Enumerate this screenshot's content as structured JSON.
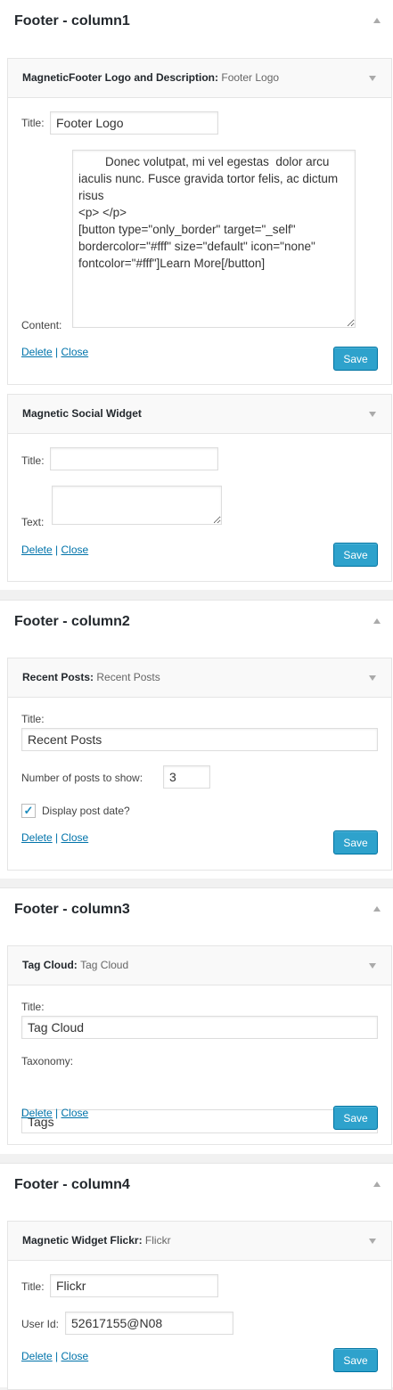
{
  "sections": [
    {
      "title": "Footer - column1",
      "widgets": [
        {
          "name": "MagneticFooter Logo and Description:",
          "instance": "Footer Logo",
          "title_label": "Title:",
          "title_value": "Footer Logo",
          "content_label": "Content:",
          "content_value": "        Donec volutpat, mi vel egestas  dolor arcu iaculis nunc. Fusce gravida tortor felis, ac dictum risus\n<p> </p>\n[button type=\"only_border\" target=\"_self\" bordercolor=\"#fff\" size=\"default\" icon=\"none\" fontcolor=\"#fff\"]Learn More[/button]",
          "delete": "Delete",
          "sep": "|",
          "close": "Close",
          "save": "Save"
        },
        {
          "name": "Magnetic Social Widget",
          "instance": "",
          "title_label": "Title:",
          "title_value": "",
          "text_label": "Text:",
          "text_value": "",
          "delete": "Delete",
          "sep": "|",
          "close": "Close",
          "save": "Save"
        }
      ]
    },
    {
      "title": "Footer - column2",
      "widgets": [
        {
          "name": "Recent Posts:",
          "instance": "Recent Posts",
          "title_label": "Title:",
          "title_value": "Recent Posts",
          "number_label": "Number of posts to show:",
          "number_value": "3",
          "checkbox_label": "Display post date?",
          "checkbox_checked": true,
          "delete": "Delete",
          "sep": "|",
          "close": "Close",
          "save": "Save"
        }
      ]
    },
    {
      "title": "Footer - column3",
      "widgets": [
        {
          "name": "Tag Cloud:",
          "instance": "Tag Cloud",
          "title_label": "Title:",
          "title_value": "Tag Cloud",
          "taxonomy_label": "Taxonomy:",
          "taxonomy_value": "Tags",
          "delete": "Delete",
          "sep": "|",
          "close": "Close",
          "save": "Save"
        }
      ]
    },
    {
      "title": "Footer - column4",
      "widgets": [
        {
          "name": "Magnetic Widget Flickr:",
          "instance": "Flickr",
          "title_label": "Title:",
          "title_value": "Flickr",
          "userid_label": "User Id:",
          "userid_value": "52617155@N08",
          "delete": "Delete",
          "sep": "|",
          "close": "Close",
          "save": "Save"
        }
      ]
    }
  ],
  "colors": {
    "accent": "#2ea2cc",
    "link": "#0073aa"
  }
}
